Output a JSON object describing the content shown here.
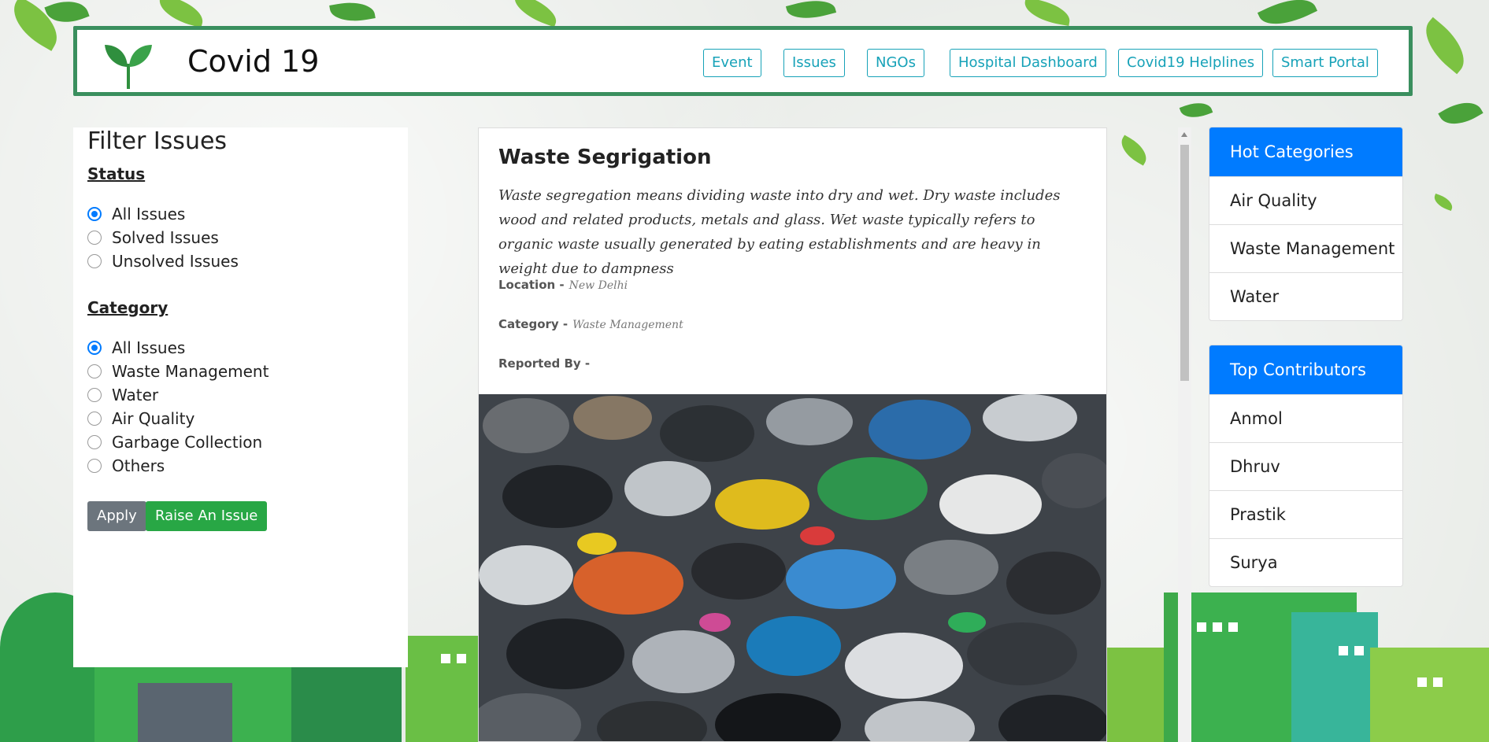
{
  "navbar": {
    "brand": "Covid 19",
    "links": [
      "Event",
      "Issues",
      "NGOs",
      "Hospital Dashboard",
      "Covid19 Helplines",
      "Smart Portal"
    ]
  },
  "filter": {
    "title": "Filter Issues",
    "status_label": "Status",
    "status_options": [
      "All Issues",
      "Solved Issues",
      "Unsolved Issues"
    ],
    "status_selected": "All Issues",
    "category_label": "Category",
    "category_options": [
      "All Issues",
      "Waste Management",
      "Water",
      "Air Quality",
      "Garbage Collection",
      "Others"
    ],
    "category_selected": "All Issues",
    "apply_label": "Apply",
    "raise_label": "Raise An Issue"
  },
  "issue": {
    "title": "Waste Segrigation",
    "description": "Waste segregation means dividing waste into dry and wet. Dry waste includes wood and related products, metals and glass. Wet waste typically refers to organic waste usually generated by eating establishments and are heavy in weight due to dampness",
    "location_label": "Location -",
    "location": "New Delhi",
    "category_label": "Category -",
    "category": "Waste Management",
    "reported_by_label": "Reported By -",
    "reported_by": ""
  },
  "hot_categories": {
    "title": "Hot Categories",
    "items": [
      "Air Quality",
      "Waste Management",
      "Water"
    ]
  },
  "top_contributors": {
    "title": "Top Contributors",
    "items": [
      "Anmol",
      "Dhruv",
      "Prastik",
      "Surya"
    ]
  },
  "colors": {
    "nav_border": "#3a8f5e",
    "nav_link": "#17a2b8",
    "primary": "#007bff",
    "apply": "#6c757d",
    "raise": "#28a745"
  },
  "icons": [
    "sprout-logo-icon"
  ]
}
